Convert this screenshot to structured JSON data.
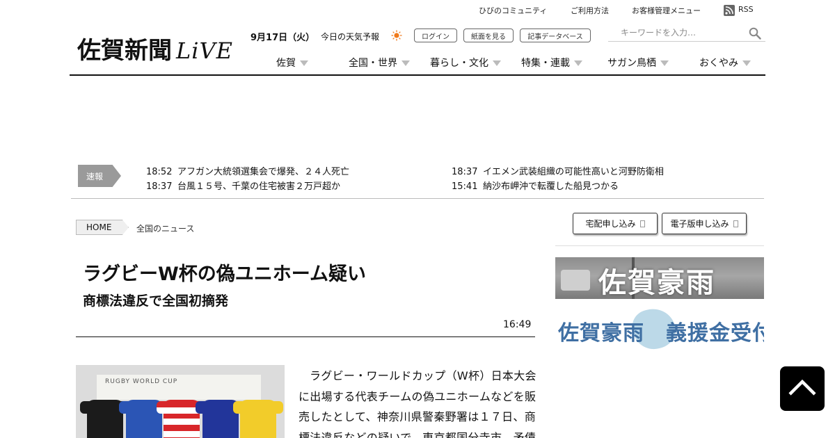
{
  "utility_links": [
    {
      "label": "ひびのコミュニティ"
    },
    {
      "label": "ご利用方法"
    },
    {
      "label": "お客様管理メニュー"
    },
    {
      "label": "RSS"
    }
  ],
  "logo": {
    "main": "佐賀新聞",
    "sub": "LiVE"
  },
  "header": {
    "date": "9月17日（火）",
    "weather_label": "今日の天気予報",
    "weather_icon": "sun-icon",
    "buttons": [
      {
        "label": "ログイン"
      },
      {
        "label": "紙面を見る"
      },
      {
        "label": "記事データベース"
      }
    ],
    "search": {
      "placeholder": "キーワードを入力…"
    }
  },
  "nav": [
    {
      "label": "佐賀"
    },
    {
      "label": "全国・世界"
    },
    {
      "label": "暮らし・文化"
    },
    {
      "label": "特集・連載"
    },
    {
      "label": "サガン鳥栖"
    },
    {
      "label": "おくやみ"
    }
  ],
  "breaking": {
    "tag": "速報",
    "items": [
      {
        "time": "18:52",
        "text": "アフガン大統領選集会で爆発、２４人死亡"
      },
      {
        "time": "18:37",
        "text": "台風１５号、千葉の住宅被害２万戸超か"
      },
      {
        "time": "18:37",
        "text": "イエメン武装組織の可能性高いと河野防衛相"
      },
      {
        "time": "15:41",
        "text": "納沙布岬沖で転覆した船見つかる"
      }
    ]
  },
  "breadcrumb": {
    "home": "HOME",
    "current": "全国のニュース"
  },
  "article": {
    "headline": "ラグビーW杯の偽ユニホーム疑い",
    "subheadline": "商標法違反で全国初摘発",
    "time": "16:49",
    "photo_board_text": "RUGBY WORLD CUP",
    "body": "ラグビー・ワールドカップ（W杯）日本大会に出場する代表チームの偽ユニホームなどを販売したとして、神奈川県警秦野署は１７日、商標法違反などの疑いで、東京都国分寺市、矛債"
  },
  "sidebar": {
    "buttons": [
      {
        "label": "宅配申し込み"
      },
      {
        "label": "電子版申し込み"
      }
    ],
    "banner_flood": "佐賀豪雨",
    "banner_donation": "佐賀豪雨　義援金受付"
  },
  "colors": {
    "text": "#111111",
    "breaking_tag": "#9a9a9a",
    "nav_arrow": "#bbbbbb",
    "donation_blue": "#3f6fa3",
    "weather_sun": "#f07a1c"
  }
}
